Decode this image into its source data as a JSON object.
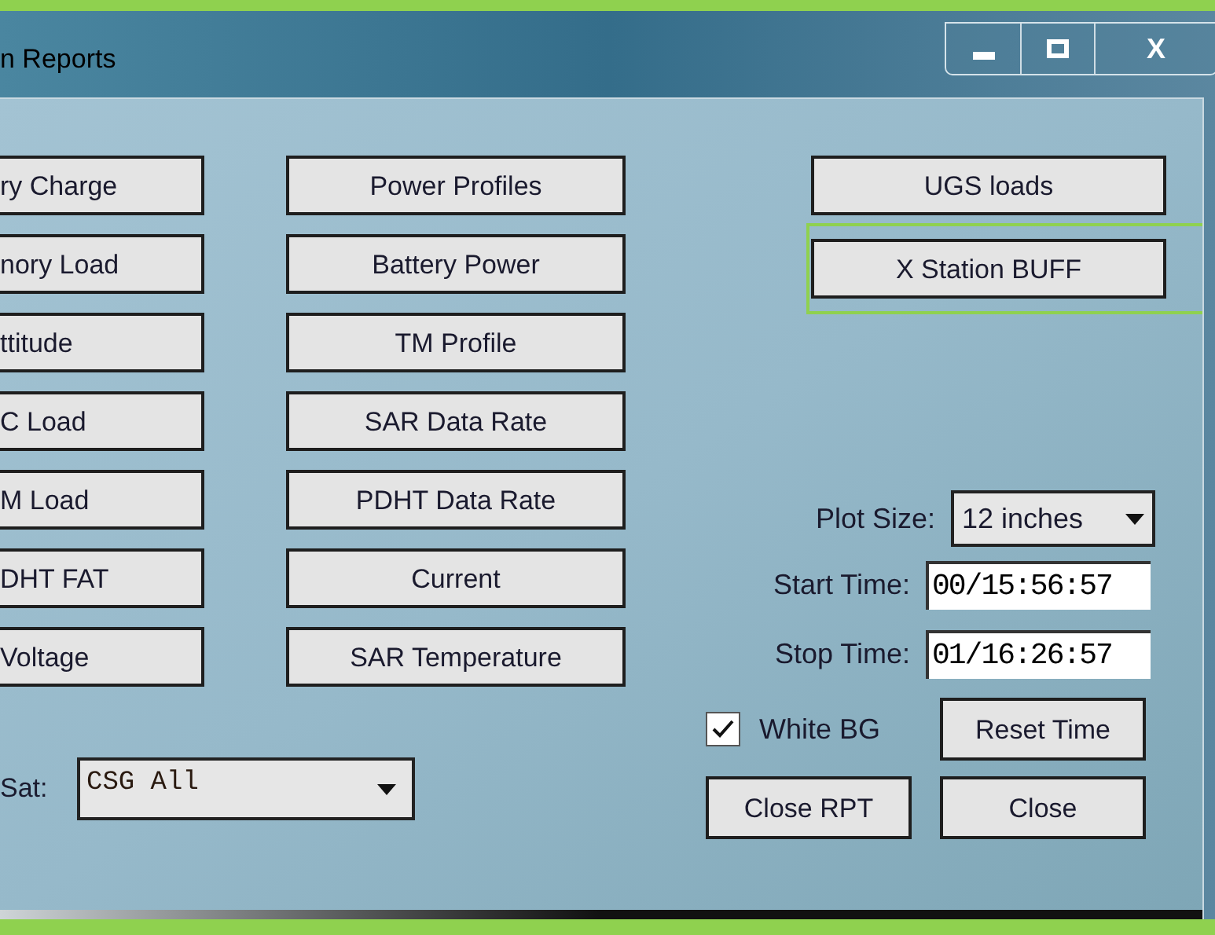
{
  "window": {
    "title": "n Reports",
    "controls": [
      {
        "kind": "minimize"
      },
      {
        "kind": "maximize"
      },
      {
        "kind": "close",
        "label": "X"
      }
    ]
  },
  "report_buttons_left": [
    "ry Charge",
    "nory Load",
    "ttitude",
    "C Load",
    "M Load",
    "DHT FAT",
    "Voltage"
  ],
  "report_buttons_middle": [
    "Power Profiles",
    "Battery Power",
    "TM Profile",
    "SAR Data Rate",
    "PDHT Data Rate",
    "Current",
    "SAR Temperature"
  ],
  "report_buttons_right": [
    {
      "label": "UGS loads",
      "highlighted": false
    },
    {
      "label": "X Station BUFF",
      "highlighted": true
    }
  ],
  "sat": {
    "label": "Sat:",
    "value": "CSG All"
  },
  "plot_size": {
    "label": "Plot Size:",
    "value": "12 inches"
  },
  "start_time": {
    "label": "Start Time:",
    "value": "00/15:56:57"
  },
  "stop_time": {
    "label": "Stop Time:",
    "value": "01/16:26:57"
  },
  "white_bg": {
    "label": "White BG",
    "checked": true
  },
  "buttons": [
    "Reset Time",
    "Close RPT",
    "Close"
  ]
}
